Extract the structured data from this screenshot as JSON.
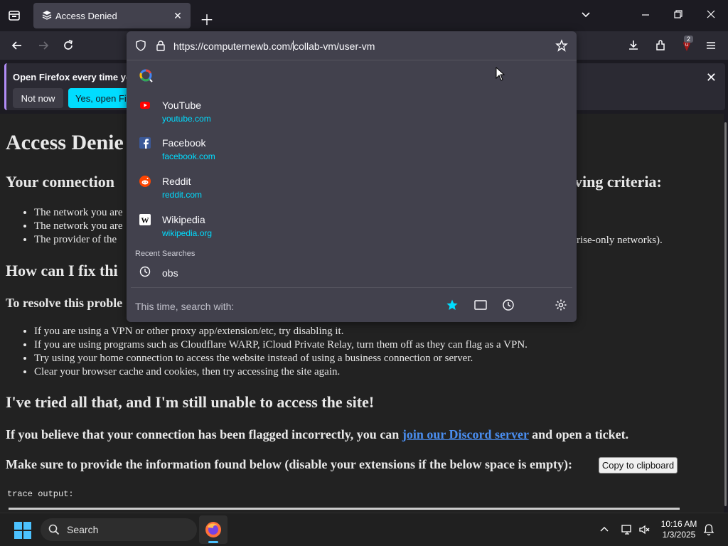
{
  "tab": {
    "title": "Access Denied"
  },
  "urlbar": {
    "url_before_caret": "https://computernewb.com/",
    "url_after_caret": "collab-vm/user-vm",
    "search_input": ""
  },
  "notification": {
    "text": "Open Firefox every time you",
    "not_now": "Not now",
    "yes_open": "Yes, open Firefox"
  },
  "suggestions": [
    {
      "name": "YouTube",
      "url": "youtube.com"
    },
    {
      "name": "Facebook",
      "url": "facebook.com"
    },
    {
      "name": "Reddit",
      "url": "reddit.com"
    },
    {
      "name": "Wikipedia",
      "url": "wikipedia.org"
    }
  ],
  "recent_searches": {
    "header": "Recent Searches",
    "items": [
      "obs"
    ]
  },
  "search_with_label": "This time, search with:",
  "extension_badge": "2",
  "page": {
    "h1": "Access Denie",
    "h2_connection": "Your connection",
    "h2_connection_tail": "ving criteria:",
    "criteria": [
      "The network you are",
      "The network you are",
      "The provider of the"
    ],
    "criteria_tail": "rise-only networks).",
    "h2_fix": "How can I fix thi",
    "resolve_heading": "To resolve this proble",
    "resolve_items": [
      "If you are using a VPN or other proxy app/extension/etc, try disabling it.",
      "If you are using programs such as Cloudflare WARP, iCloud Private Relay, turn them off as they can flag as a VPN.",
      "Try using your home connection to access the website instead of using a business connection or server.",
      "Clear your browser cache and cookies, then try accessing the site again."
    ],
    "h2_tried": "I've tried all that, and I'm still unable to access the site!",
    "p_flagged_before": "If you believe that your connection has been flagged incorrectly, you can ",
    "p_flagged_link": "join our Discord server",
    "p_flagged_after": " and open a ticket.",
    "p_provide": "Make sure to provide the information found below (disable your extensions if the below space is empty):",
    "copy_button": "Copy to clipboard",
    "trace_label": "trace output:"
  },
  "taskbar": {
    "search_label": "Search",
    "time": "10:16 AM",
    "date": "1/3/2025"
  }
}
